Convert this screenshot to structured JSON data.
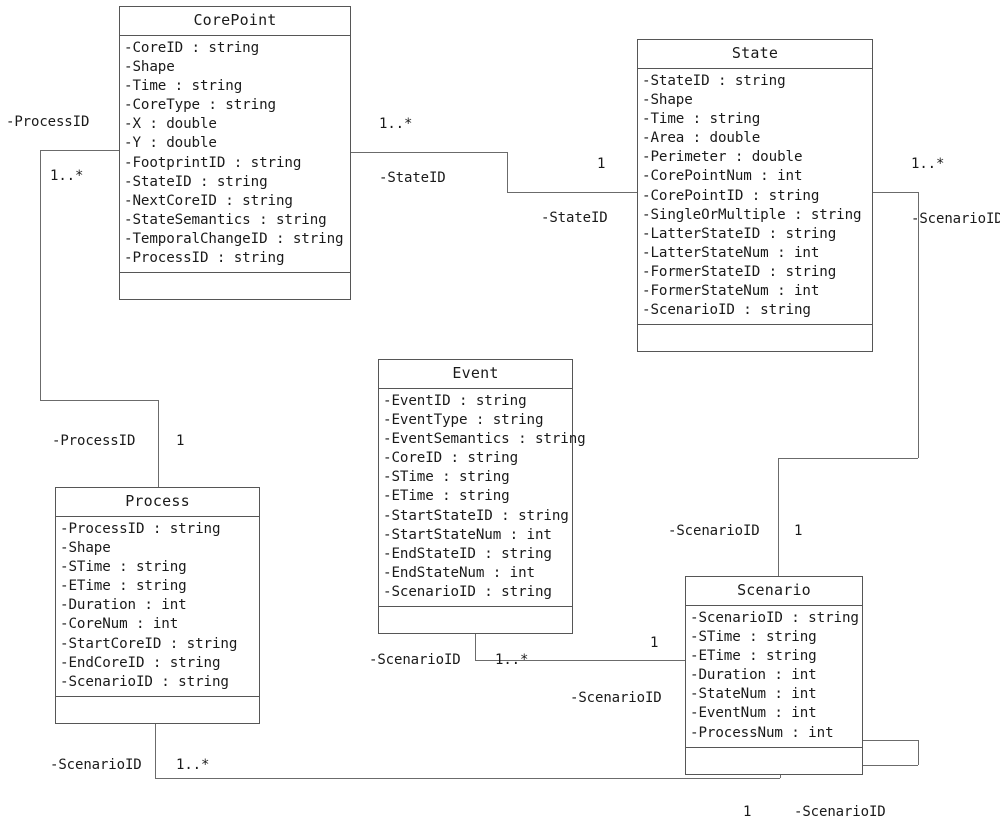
{
  "diagram": {
    "type": "uml-class-diagram",
    "classes": [
      {
        "id": "corepoint",
        "name": "CorePoint",
        "attributes": [
          "-CoreID : string",
          "-Shape",
          "-Time : string",
          "-CoreType : string",
          "-X : double",
          "-Y : double",
          "-FootprintID : string",
          "-StateID : string",
          "-NextCoreID : string",
          "-StateSemantics : string",
          "-TemporalChangeID : string",
          "-ProcessID : string"
        ]
      },
      {
        "id": "state",
        "name": "State",
        "attributes": [
          "-StateID : string",
          "-Shape",
          "-Time : string",
          "-Area : double",
          "-Perimeter : double",
          "-CorePointNum : int",
          "-CorePointID : string",
          "-SingleOrMultiple : string",
          "-LatterStateID : string",
          "-LatterStateNum : int",
          "-FormerStateID : string",
          "-FormerStateNum : int",
          "-ScenarioID : string"
        ]
      },
      {
        "id": "event",
        "name": "Event",
        "attributes": [
          "-EventID : string",
          "-EventType : string",
          "-EventSemantics : string",
          "-CoreID : string",
          "-STime : string",
          "-ETime : string",
          "-StartStateID : string",
          "-StartStateNum : int",
          "-EndStateID : string",
          "-EndStateNum : int",
          "-ScenarioID : string"
        ]
      },
      {
        "id": "process",
        "name": "Process",
        "attributes": [
          "-ProcessID : string",
          "-Shape",
          "-STime : string",
          "-ETime : string",
          "-Duration : int",
          "-CoreNum : int",
          "-StartCoreID : string",
          "-EndCoreID : string",
          "-ScenarioID : string"
        ]
      },
      {
        "id": "scenario",
        "name": "Scenario",
        "attributes": [
          "-ScenarioID : string",
          "-STime : string",
          "-ETime : string",
          "-Duration : int",
          "-StateNum : int",
          "-EventNum : int",
          "-ProcessNum : int"
        ]
      }
    ],
    "associations": [
      {
        "id": "corepoint-process",
        "from": "corepoint",
        "to": "process",
        "from_role": "-ProcessID",
        "from_multiplicity": "1..*",
        "to_role": "-ProcessID",
        "to_multiplicity": "1"
      },
      {
        "id": "corepoint-state",
        "from": "corepoint",
        "to": "state",
        "from_role": "-StateID",
        "from_multiplicity": "1..*",
        "to_role": "-StateID",
        "to_multiplicity": "1"
      },
      {
        "id": "state-scenario",
        "from": "state",
        "to": "scenario",
        "from_role": "-ScenarioID",
        "from_multiplicity": "1..*",
        "to_role": "-ScenarioID",
        "to_multiplicity": "1"
      },
      {
        "id": "event-scenario",
        "from": "event",
        "to": "scenario",
        "from_role": "-ScenarioID",
        "from_multiplicity": "1..*",
        "to_role": "-ScenarioID",
        "to_multiplicity": "1"
      },
      {
        "id": "process-scenario",
        "from": "process",
        "to": "scenario",
        "from_role": "-ScenarioID",
        "from_multiplicity": "1..*",
        "to_role": "-ScenarioID",
        "to_multiplicity": "1"
      }
    ],
    "labels": {
      "corepoint_process_left_role": "-ProcessID",
      "corepoint_process_left_mult": "1..*",
      "corepoint_process_bottom_role": "-ProcessID",
      "corepoint_process_bottom_mult": "1",
      "corepoint_state_mult_src": "1..*",
      "corepoint_state_role_src": "-StateID",
      "corepoint_state_mult_dst": "1",
      "corepoint_state_role_dst": "-StateID",
      "state_scenario_mult_src": "1..*",
      "state_scenario_role_src": "-ScenarioID",
      "state_scenario_role_dst": "-ScenarioID",
      "state_scenario_mult_dst": "1",
      "event_scenario_role_src": "-ScenarioID",
      "event_scenario_mult_src": "1..*",
      "event_scenario_mult_dst": "1",
      "event_scenario_role_dst": "-ScenarioID",
      "process_scenario_role_src": "-ScenarioID",
      "process_scenario_mult_src": "1..*",
      "process_scenario_mult_dst": "1",
      "process_scenario_role_dst": "-ScenarioID"
    },
    "colors": {
      "box_border": "#565656",
      "connector": "#6b6b6b",
      "background": "#ffffff",
      "text": "#1a1a1a"
    }
  }
}
